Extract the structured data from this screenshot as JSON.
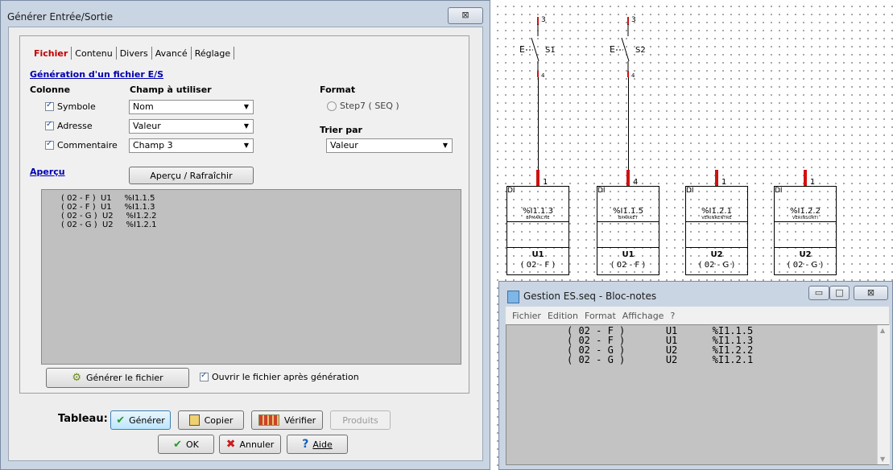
{
  "dialog": {
    "title": "Générer Entrée/Sortie",
    "close_label": "⊠",
    "tabs": [
      "Fichier",
      "Contenu",
      "Divers",
      "Avancé",
      "Réglage"
    ],
    "section_title": "Génération d'un fichier E/S",
    "col_header": "Colonne",
    "field_header": "Champ à utiliser",
    "rows": [
      {
        "label": "Symbole",
        "checked": true,
        "value": "Nom"
      },
      {
        "label": "Adresse",
        "checked": true,
        "value": "Valeur"
      },
      {
        "label": "Commentaire",
        "checked": true,
        "value": "Champ 3"
      }
    ],
    "format_label": "Format",
    "format_option": "Step7 ( SEQ )",
    "sort_label": "Trier par",
    "sort_value": "Valeur",
    "apercu_label": "Aperçu",
    "apercu_button": "Aperçu / Rafraîchir",
    "preview_lines": [
      "( 02 - F )  U1     %I1.1.5",
      "( 02 - F )  U1     %I1.1.3",
      "( 02 - G )  U2     %I1.2.2",
      "( 02 - G )  U2     %I1.2.1"
    ],
    "generate_file_button": "Générer le fichier",
    "open_after_label": "Ouvrir le fichier après génération",
    "tableau_label": "Tableau:",
    "tableau_buttons": [
      "Générer",
      "Copier",
      "Vérifier",
      "Produits"
    ],
    "ok_label": "OK",
    "cancel_label": "Annuler",
    "help_label": "Aide"
  },
  "schematic": {
    "switches": [
      {
        "label": "S1",
        "top": "3",
        "bottom": "4",
        "prefix": "E"
      },
      {
        "label": "S2",
        "top": "3",
        "bottom": "4",
        "prefix": "E"
      }
    ],
    "blocks": [
      {
        "pin": "1",
        "type": "DI",
        "address": "%I1.1.3",
        "desc": "BPMARCHE",
        "name": "U1",
        "ref": "( 02 - F )"
      },
      {
        "pin": "4",
        "type": "DI",
        "address": "%I1.1.5",
        "desc": "BPARRET",
        "name": "U1",
        "ref": "( 02 - F )"
      },
      {
        "pin": "1",
        "type": "DI",
        "address": "%I1.2.1",
        "desc": "VERINRENTRE",
        "name": "U2",
        "ref": "( 02 - G )"
      },
      {
        "pin": "1",
        "type": "DI",
        "address": "%I1.2.2",
        "desc": "VERINSORTI",
        "name": "U2",
        "ref": "( 02 - G )"
      }
    ]
  },
  "notepad": {
    "title": "Gestion ES.seq - Bloc-notes",
    "menu": [
      "Fichier",
      "Edition",
      "Format",
      "Affichage",
      "?"
    ],
    "lines": [
      "( 02 - F )       U1      %I1.1.5",
      "( 02 - F )       U1      %I1.1.3",
      "( 02 - G )       U2      %I1.2.2",
      "( 02 - G )       U2      %I1.2.1"
    ],
    "min_label": "▭",
    "max_label": "□",
    "close_label": "⊠"
  }
}
